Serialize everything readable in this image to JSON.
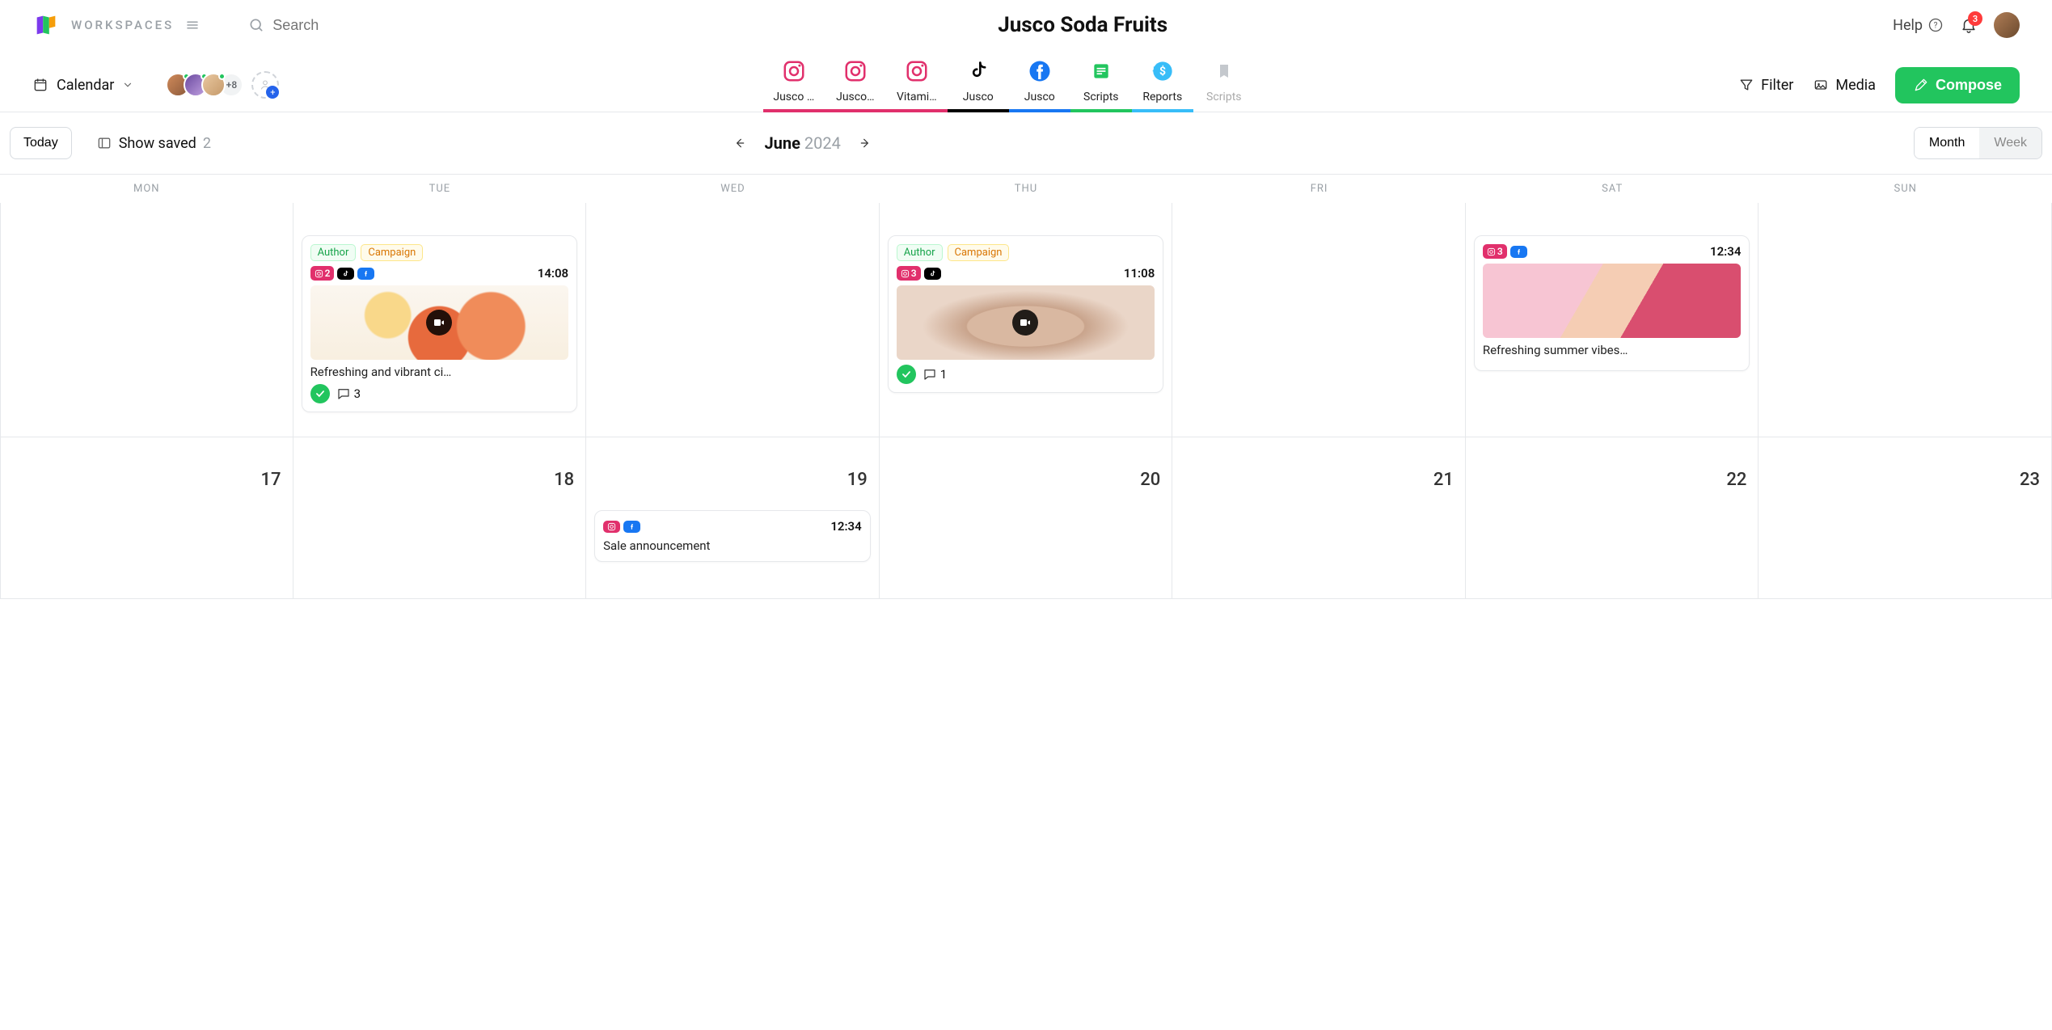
{
  "header": {
    "workspaces_label": "WORKSPACES",
    "search_placeholder": "Search",
    "page_title": "Jusco Soda Fruits",
    "help_label": "Help",
    "notification_count": "3"
  },
  "subheader": {
    "view_label": "Calendar",
    "team_more_count": "+8",
    "channels": [
      {
        "label": "Jusco …",
        "platform": "instagram",
        "bar_color": "#e1306c"
      },
      {
        "label": "Jusco…",
        "platform": "instagram",
        "bar_color": "#e1306c"
      },
      {
        "label": "Vitami…",
        "platform": "instagram",
        "bar_color": "#e1306c"
      },
      {
        "label": "Jusco",
        "platform": "tiktok",
        "bar_color": "#000000"
      },
      {
        "label": "Jusco",
        "platform": "facebook",
        "bar_color": "#1877f2"
      },
      {
        "label": "Scripts",
        "platform": "doc",
        "bar_color": "#22c55e"
      },
      {
        "label": "Reports",
        "platform": "money",
        "bar_color": "#38bdf8"
      },
      {
        "label": "Scripts",
        "platform": "bookmark",
        "bar_color": "",
        "dim": true
      }
    ],
    "filter_label": "Filter",
    "media_label": "Media",
    "compose_label": "Compose"
  },
  "calendar": {
    "today_label": "Today",
    "show_saved_label": "Show saved",
    "show_saved_count": "2",
    "month": "June",
    "year": "2024",
    "view_month": "Month",
    "view_week": "Week",
    "days_of_week": [
      "MON",
      "TUE",
      "WED",
      "THU",
      "FRI",
      "SAT",
      "SUN"
    ],
    "row2_numbers": [
      "17",
      "18",
      "19",
      "20",
      "21",
      "22",
      "23"
    ]
  },
  "cards": {
    "tue": {
      "tag_author": "Author",
      "tag_campaign": "Campaign",
      "ig_count": "2",
      "time": "14:08",
      "caption": "Refreshing and vibrant ci…",
      "comments": "3"
    },
    "thu": {
      "tag_author": "Author",
      "tag_campaign": "Campaign",
      "ig_count": "3",
      "time": "11:08",
      "comments": "1"
    },
    "sat": {
      "ig_count": "3",
      "time": "12:34",
      "caption": "Refreshing summer vibes…"
    },
    "wed2": {
      "time": "12:34",
      "caption": "Sale announcement"
    }
  }
}
